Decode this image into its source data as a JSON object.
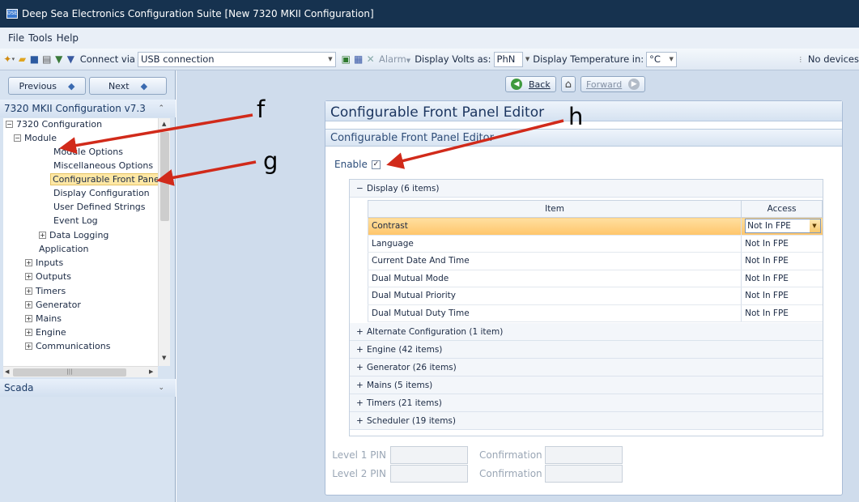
{
  "window": {
    "title": "Deep Sea Electronics Configuration Suite [New 7320 MKII Configuration]",
    "app_icon_text": "DSE"
  },
  "menu": [
    "File",
    "Tools",
    "Help"
  ],
  "toolbar": {
    "connect_label": "Connect via",
    "connect_value": "USB connection",
    "alarm_label": "Alarm",
    "volts_label": "Display Volts as:",
    "volts_value": "PhN",
    "temp_label": "Display Temperature in:",
    "temp_value": "°C",
    "devices_label": "No devices"
  },
  "left": {
    "previous_label": "Previous",
    "next_label": "Next",
    "tree_header": "7320 MKII Configuration v7.3",
    "scada_label": "Scada",
    "tree": {
      "root": "7320 Configuration",
      "module": "Module",
      "module_options": "Module Options",
      "misc_options": "Miscellaneous Options",
      "fpe": "Configurable Front Panel",
      "display_config": "Display Configuration",
      "user_strings": "User Defined Strings",
      "event_log": "Event Log",
      "data_logging": "Data Logging",
      "application": "Application",
      "inputs": "Inputs",
      "outputs": "Outputs",
      "timers": "Timers",
      "generator": "Generator",
      "mains": "Mains",
      "engine": "Engine",
      "communications": "Communications"
    }
  },
  "nav": {
    "back_label": "Back",
    "forward_label": "Forward"
  },
  "editor": {
    "title": "Configurable Front Panel Editor",
    "subtitle": "Configurable Front Panel Editor",
    "enable_label": "Enable",
    "display_group": "Display (6 items)",
    "col_item": "Item",
    "col_access": "Access",
    "rows": [
      {
        "item": "Contrast",
        "access": "Not In FPE"
      },
      {
        "item": "Language",
        "access": "Not In FPE"
      },
      {
        "item": "Current Date And Time",
        "access": "Not In FPE"
      },
      {
        "item": "Dual Mutual Mode",
        "access": "Not In FPE"
      },
      {
        "item": "Dual Mutual Priority",
        "access": "Not In FPE"
      },
      {
        "item": "Dual Mutual Duty Time",
        "access": "Not In FPE"
      }
    ],
    "groups": [
      "Alternate Configuration (1 item)",
      "Engine (42 items)",
      "Generator (26 items)",
      "Mains (5 items)",
      "Timers (21 items)",
      "Scheduler (19 items)"
    ],
    "level1_pin": "Level 1 PIN",
    "level2_pin": "Level 2 PIN",
    "confirmation": "Confirmation"
  },
  "annotations": {
    "f": "f",
    "g": "g",
    "h": "h"
  }
}
